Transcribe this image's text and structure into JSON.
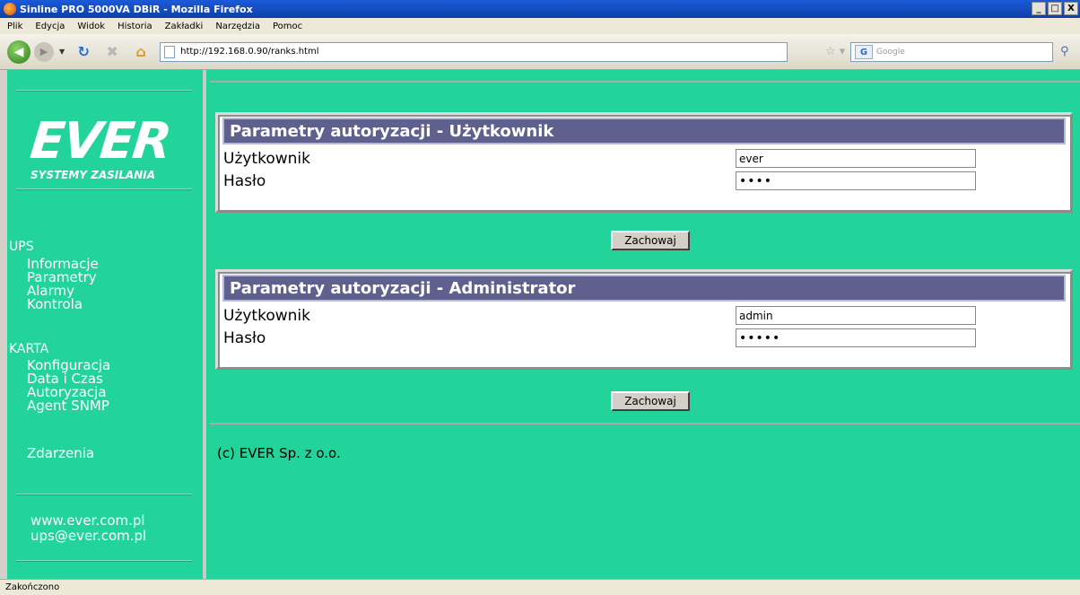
{
  "window": {
    "title": "Sinline PRO 5000VA DBiR - Mozilla Firefox",
    "buttons": [
      "_",
      "□",
      "X"
    ]
  },
  "menubar": [
    "Plik",
    "Edycja",
    "Widok",
    "Historia",
    "Zakładki",
    "Narzędzia",
    "Pomoc"
  ],
  "navbar": {
    "url": "http://192.168.0.90/ranks.html",
    "search_placeholder": "Google",
    "search_engine": "G"
  },
  "sidebar": {
    "logo_main": "EVER",
    "logo_sub": "SYSTEMY ZASILANIA",
    "ups_header": "UPS",
    "ups_links": [
      "Informacje",
      "Parametry",
      "Alarmy",
      "Kontrola"
    ],
    "karta_header": "KARTA",
    "karta_links": [
      "Konfiguracja",
      "Data i Czas",
      "Autoryzacja",
      "Agent SNMP"
    ],
    "zdarzenia": "Zdarzenia",
    "website": "www.ever.com.pl",
    "email": "ups@ever.com.pl"
  },
  "panels": [
    {
      "title": "Parametry autoryzacji - Użytkownik",
      "user_label": "Użytkownik",
      "user_value": "ever",
      "pass_label": "Hasło",
      "pass_value": "••••",
      "save_label": "Zachowaj"
    },
    {
      "title": "Parametry autoryzacji - Administrator",
      "user_label": "Użytkownik",
      "user_value": "admin",
      "pass_label": "Hasło",
      "pass_value": "•••••",
      "save_label": "Zachowaj"
    }
  ],
  "copyright": "(c) EVER Sp. z o.o.",
  "status": "Zakończono"
}
